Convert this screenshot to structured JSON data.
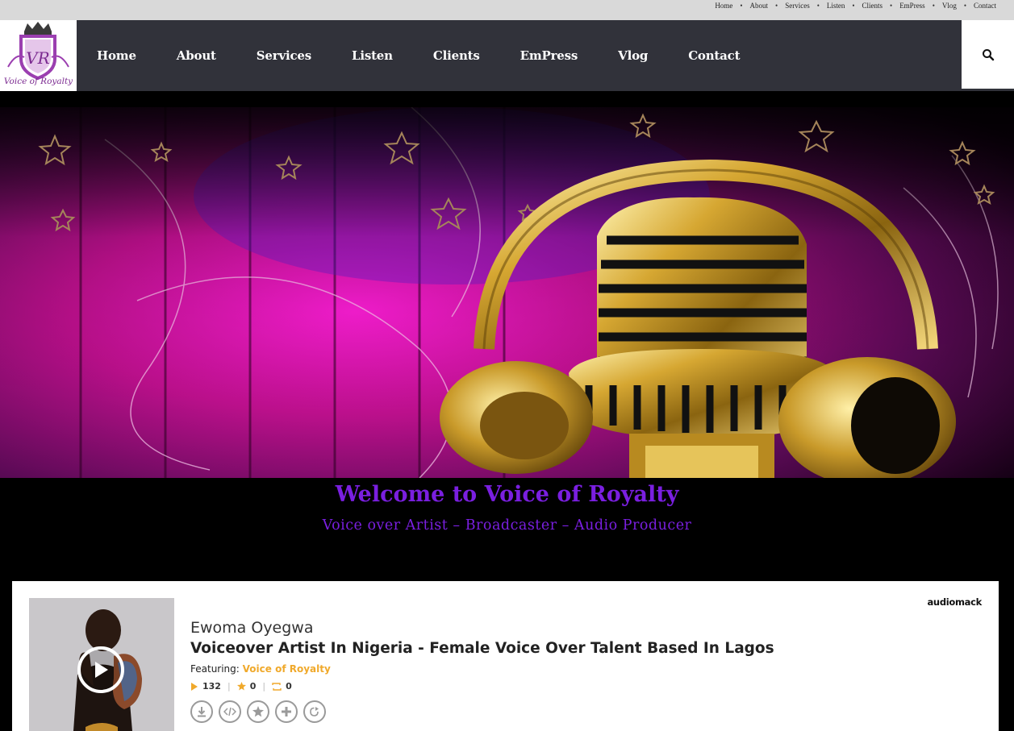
{
  "top_menu": [
    "Home",
    "About",
    "Services",
    "Listen",
    "Clients",
    "EmPress",
    "Vlog",
    "Contact"
  ],
  "top_menu_separator": "•",
  "logo": {
    "text": "Voice of Royalty",
    "monogram": "VR"
  },
  "main_nav": [
    "Home",
    "About",
    "Services",
    "Listen",
    "Clients",
    "EmPress",
    "Vlog",
    "Contact"
  ],
  "search_icon": "search-icon",
  "hero": {
    "welcome": "Welcome to Voice of Royalty",
    "tagline": "Voice over Artist – Broadcaster – Audio Producer"
  },
  "colors": {
    "accent_purple": "#7a1fe0",
    "nav_bg": "#31323a",
    "featuring_orange": "#f0a92b"
  },
  "player": {
    "brand": "audiomack",
    "artist": "Ewoma Oyegwa",
    "title": "Voiceover Artist In Nigeria - Female Voice Over Talent Based In Lagos",
    "featuring_label": "Featuring:",
    "featuring_name": "Voice of Royalty",
    "plays": "132",
    "favorites": "0",
    "reposts": "0",
    "actions": [
      "download-icon",
      "embed-icon",
      "favorite-icon",
      "add-icon",
      "share-icon"
    ]
  }
}
